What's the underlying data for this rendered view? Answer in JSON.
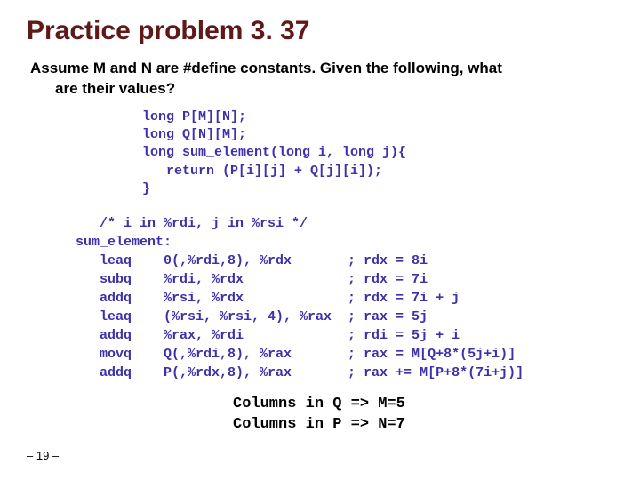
{
  "title": "Practice problem 3. 37",
  "subtitle_line1": "Assume M and N are #define constants.  Given the following, what",
  "subtitle_line2": "are their values?",
  "code_block1": "long P[M][N];\nlong Q[N][M];\nlong sum_element(long i, long j){\n   return (P[i][j] + Q[j][i]);\n}",
  "code_block2": "   /* i in %rdi, j in %rsi */\nsum_element:\n   leaq    0(,%rdi,8), %rdx       ; rdx = 8i\n   subq    %rdi, %rdx             ; rdx = 7i\n   addq    %rsi, %rdx             ; rdx = 7i + j\n   leaq    (%rsi, %rsi, 4), %rax  ; rax = 5j\n   addq    %rax, %rdi             ; rdi = 5j + i\n   movq    Q(,%rdi,8), %rax       ; rax = M[Q+8*(5j+i)]\n   addq    P(,%rdx,8), %rax       ; rax += M[P+8*(7i+j)]",
  "conclusion": "Columns in Q => M=5\nColumns in P => N=7",
  "pagenum": "– 19 –",
  "chart_data": {
    "type": "table",
    "title": "Practice problem 3.37 — deduce M and N from assembly",
    "c_source": {
      "arrays": [
        "long P[M][N];",
        "long Q[N][M];"
      ],
      "function": "long sum_element(long i, long j){ return (P[i][j] + Q[j][i]); }"
    },
    "register_args": {
      "i": "%rdi",
      "j": "%rsi"
    },
    "assembly": [
      {
        "op": "leaq",
        "args": "0(,%rdi,8), %rdx",
        "comment": "rdx = 8i"
      },
      {
        "op": "subq",
        "args": "%rdi, %rdx",
        "comment": "rdx = 7i"
      },
      {
        "op": "addq",
        "args": "%rsi, %rdx",
        "comment": "rdx = 7i + j"
      },
      {
        "op": "leaq",
        "args": "(%rsi, %rsi, 4), %rax",
        "comment": "rax = 5j"
      },
      {
        "op": "addq",
        "args": "%rax, %rdi",
        "comment": "rdi = 5j + i"
      },
      {
        "op": "movq",
        "args": "Q(,%rdi,8), %rax",
        "comment": "rax = M[Q+8*(5j+i)]"
      },
      {
        "op": "addq",
        "args": "P(,%rdx,8), %rax",
        "comment": "rax += M[P+8*(7i+j)]"
      }
    ],
    "answer": {
      "M": 5,
      "N": 7,
      "reasoning": [
        "Columns in Q => M=5",
        "Columns in P => N=7"
      ]
    }
  }
}
